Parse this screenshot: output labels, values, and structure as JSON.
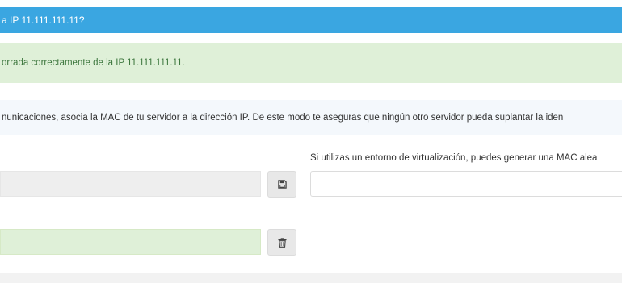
{
  "dialog": {
    "title": "a IP 11.111.111.11?"
  },
  "alert": {
    "message": "orrada correctamente de la IP 11.111.111.11."
  },
  "info": {
    "text": "nunicaciones, asocia la MAC de tu servidor a la dirección IP. De este modo te aseguras que ningún otro servidor pueda suplantar la iden"
  },
  "virtualization": {
    "label": "Si utilizas un entorno de virtualización, puedes generar una MAC alea"
  },
  "icons": {
    "save": "floppy-disk-icon",
    "delete": "trash-icon"
  },
  "colors": {
    "header": "#3aa6e1",
    "success_bg": "#dff0d8",
    "success_text": "#3c763d"
  }
}
